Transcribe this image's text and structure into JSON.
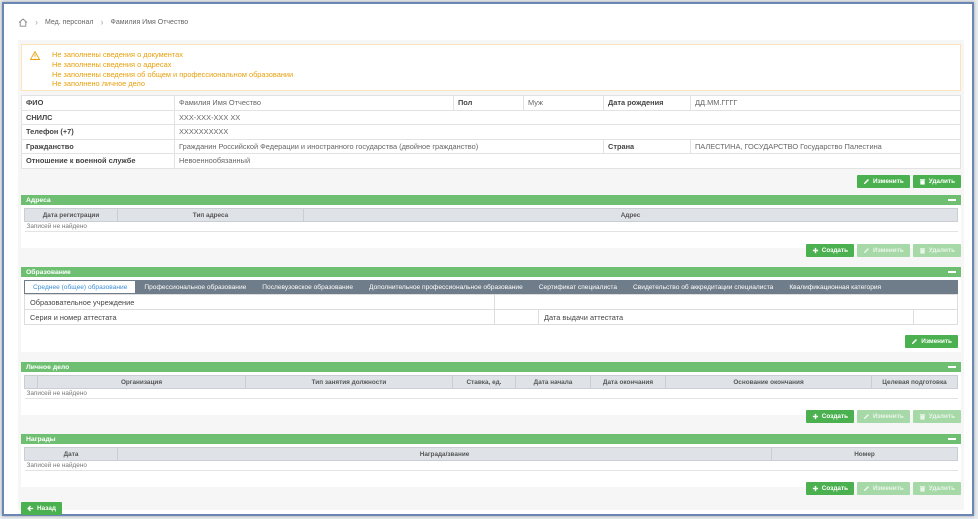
{
  "breadcrumb": {
    "items": [
      "Мед. персонал",
      "Фамилия Имя Отчество"
    ]
  },
  "warnings": [
    "Не заполнены сведения о документах",
    "Не заполнены сведения о адресах",
    "Не заполнены сведения об общем и профессиональном образовании",
    "Не заполнено личное дело"
  ],
  "person": {
    "fio_label": "ФИО",
    "fio": "Фамилия Имя Отчество",
    "gender_label": "Пол",
    "gender": "Муж",
    "birth_label": "Дата рождения",
    "birth": "ДД.ММ.ГГГГ",
    "snils_label": "СНИЛС",
    "snils": "XXX-XXX-XXX XX",
    "phone_label": "Телефон (+7)",
    "phone": "XXXXXXXXXX",
    "citizenship_label": "Гражданство",
    "citizenship": "Гражданин Российской Федерации и иностранного государства (двойное гражданство)",
    "country_label": "Страна",
    "country": "ПАЛЕСТИНА, ГОСУДАРСТВО Государство Палестина",
    "military_label": "Отношение к военной службе",
    "military": "Невоеннообязанный"
  },
  "buttons": {
    "edit": "Изменить",
    "delete": "Удалить",
    "create": "Создать",
    "back": "Назад"
  },
  "addresses": {
    "title": "Адреса",
    "columns": [
      "Дата регистрации",
      "Тип адреса",
      "Адрес"
    ],
    "empty": "Записей не найдено"
  },
  "education": {
    "title": "Образование",
    "tabs": [
      "Среднее (общее) образование",
      "Профессиональное образование",
      "Послевузовское образование",
      "Дополнительное профессиональное образование",
      "Сертификат специалиста",
      "Свидетельство об аккредитации специалиста",
      "Квалификационная категория"
    ],
    "institution_label": "Образовательное учреждение",
    "certificate_label": "Серия и номер аттестата",
    "issue_date_label": "Дата выдачи аттестата"
  },
  "personal_file": {
    "title": "Личное дело",
    "columns": [
      "Организация",
      "Тип занятия должности",
      "Ставка, ед.",
      "Дата начала",
      "Дата окончания",
      "Основание окончания",
      "Целевая подготовка"
    ],
    "empty": "Записей не найдено"
  },
  "awards": {
    "title": "Награды",
    "columns": [
      "Дата",
      "Награда/звание",
      "Номер"
    ],
    "empty": "Записей не найдено"
  },
  "colors": {
    "accent": "#4bb04f",
    "panel_header": "#6ebf72",
    "warning": "#e8a00c",
    "tab_bar": "#6f7c89"
  }
}
